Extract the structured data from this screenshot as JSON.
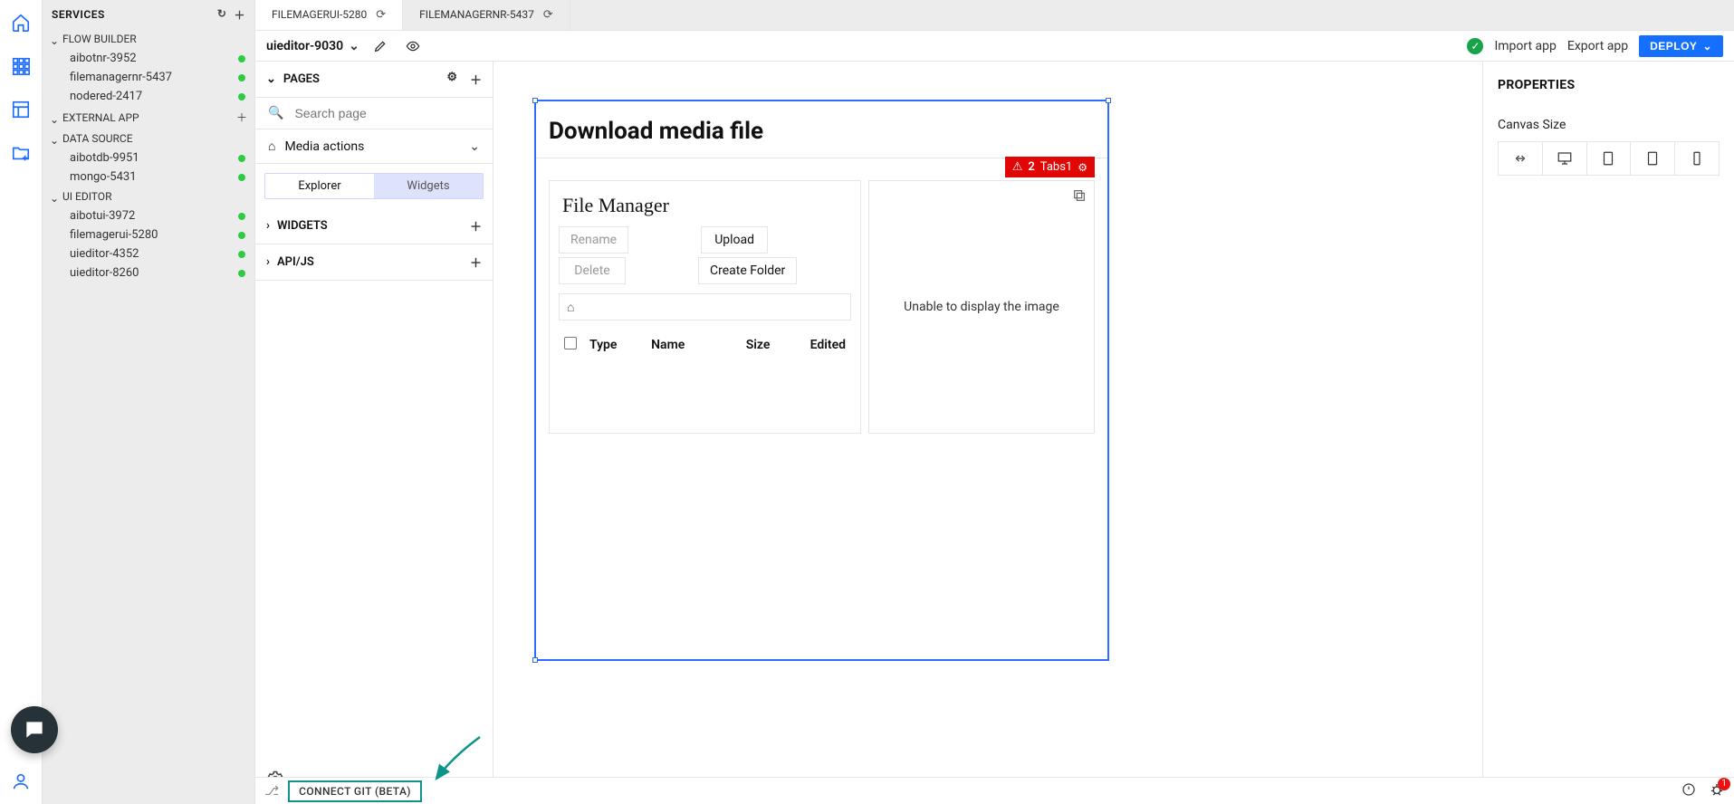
{
  "services": {
    "title": "SERVICES",
    "groups": [
      {
        "key": "flow_builder",
        "label": "FLOW BUILDER",
        "collapsible": true,
        "plus": false,
        "items": [
          {
            "label": "aibotnr-3952",
            "status": "green"
          },
          {
            "label": "filemanagernr-5437",
            "status": "green"
          },
          {
            "label": "nodered-2417",
            "status": "green"
          }
        ]
      },
      {
        "key": "external_app",
        "label": "EXTERNAL APP",
        "collapsible": true,
        "plus": true,
        "items": []
      },
      {
        "key": "data_source",
        "label": "DATA SOURCE",
        "collapsible": true,
        "plus": false,
        "items": [
          {
            "label": "aibotdb-9951",
            "status": "green"
          },
          {
            "label": "mongo-5431",
            "status": "green"
          }
        ]
      },
      {
        "key": "ui_editor",
        "label": "UI EDITOR",
        "collapsible": true,
        "plus": false,
        "items": [
          {
            "label": "aibotui-3972",
            "status": "green"
          },
          {
            "label": "filemagerui-5280",
            "status": "green"
          },
          {
            "label": "uieditor-4352",
            "status": "green"
          },
          {
            "label": "uieditor-8260",
            "status": "green"
          }
        ]
      }
    ]
  },
  "window_tabs": [
    {
      "label": "FILEMAGERUI-5280",
      "active": true
    },
    {
      "label": "FILEMANAGERNR-5437",
      "active": false
    }
  ],
  "subbar": {
    "project": "uieditor-9030",
    "import": "Import app",
    "export": "Export app",
    "deploy": "DEPLOY"
  },
  "pages": {
    "header": "PAGES",
    "search_placeholder": "Search page",
    "current_page": "Media actions",
    "tabs": {
      "explorer": "Explorer",
      "widgets": "Widgets"
    },
    "widgets_header": "WIDGETS",
    "apijs_header": "API/JS"
  },
  "canvas": {
    "title": "Download media file",
    "badge": {
      "count": "2",
      "label": "Tabs1"
    },
    "file_manager": {
      "title": "File Manager",
      "rename": "Rename",
      "upload": "Upload",
      "delete": "Delete",
      "create_folder": "Create Folder",
      "columns": {
        "type": "Type",
        "name": "Name",
        "size": "Size",
        "edited": "Edited"
      }
    },
    "image_card": {
      "message": "Unable to display the image"
    }
  },
  "props": {
    "title": "PROPERTIES",
    "canvas_size": "Canvas Size"
  },
  "bottom": {
    "git": "CONNECT GIT (BETA)",
    "bug_count": "1"
  }
}
